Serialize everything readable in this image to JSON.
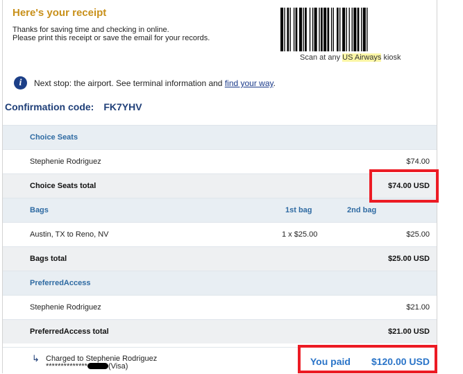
{
  "header": {
    "title": "Here's your receipt",
    "intro_line1": "Thanks for saving time and checking in online.",
    "intro_line2": "Please print this receipt or save the email for your records.",
    "kiosk_pre": "Scan at any ",
    "kiosk_brand": "US Airways",
    "kiosk_post": " kiosk"
  },
  "next_stop": {
    "text": "Next stop: the airport. See terminal information and ",
    "link": "find your way",
    "suffix": "."
  },
  "confirmation": {
    "label": "Confirmation code:",
    "code": "FK7YHV"
  },
  "sections": {
    "choice_seats": {
      "header": "Choice Seats",
      "item_name": "Stephenie Rodriguez",
      "item_amount": "$74.00",
      "total_label": "Choice Seats total",
      "total_amount": "$74.00 USD"
    },
    "bags": {
      "header": "Bags",
      "col1": "1st bag",
      "col2": "2nd bag",
      "item_name": "Austin, TX to Reno, NV",
      "item_qty": "1 x $25.00",
      "item_amount": "$25.00",
      "total_label": "Bags total",
      "total_amount": "$25.00 USD"
    },
    "preferred": {
      "header": "PreferredAccess",
      "item_name": "Stephenie Rodriguez",
      "item_amount": "$21.00",
      "total_label": "PreferredAccess total",
      "total_amount": "$21.00 USD"
    }
  },
  "payment": {
    "charged_to": "Charged to Stephenie Rodriguez",
    "card_mask": "**************",
    "card_type": "(Visa)",
    "you_paid_label": "You paid",
    "you_paid_amount": "$120.00 USD"
  },
  "colors": {
    "title": "#c8901a",
    "section_header_text": "#2e6aa2",
    "highlight_box": "#ec1b24",
    "paid_text": "#2a74c8"
  }
}
